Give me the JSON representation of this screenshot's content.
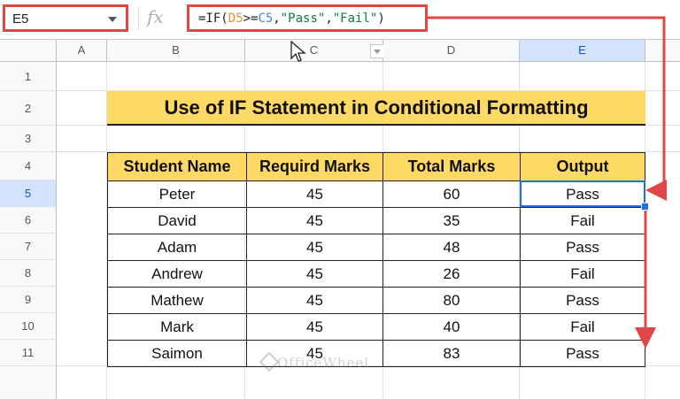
{
  "name_box": {
    "value": "E5"
  },
  "formula_bar": {
    "fx_label": "fx",
    "tokens": [
      "=IF(",
      "D5",
      ">=",
      "C5",
      ",",
      "\"Pass\"",
      ",",
      "\"Fail\"",
      ")"
    ]
  },
  "columns": [
    "A",
    "B",
    "C",
    "D",
    "E"
  ],
  "rows": [
    "1",
    "2",
    "3",
    "4",
    "5",
    "6",
    "7",
    "8",
    "9",
    "10",
    "11"
  ],
  "title": "Use of IF Statement in Conditional Formatting",
  "table": {
    "headers": [
      "Student Name",
      "Requird Marks",
      "Total Marks",
      "Output"
    ],
    "rows": [
      [
        "Peter",
        "45",
        "60",
        "Pass"
      ],
      [
        "David",
        "45",
        "35",
        "Fail"
      ],
      [
        "Adam",
        "45",
        "48",
        "Pass"
      ],
      [
        "Andrew",
        "45",
        "26",
        "Fail"
      ],
      [
        "Mathew",
        "45",
        "80",
        "Pass"
      ],
      [
        "Mark",
        "45",
        "40",
        "Fail"
      ],
      [
        "Saimon",
        "45",
        "83",
        "Pass"
      ]
    ]
  },
  "watermark": "OfficeWheel",
  "colors": {
    "highlight_border": "#e04848",
    "header_fill": "#ffd966",
    "selection": "#1a73e8",
    "ref_d": "#e69138",
    "ref_c": "#4a86e8"
  }
}
